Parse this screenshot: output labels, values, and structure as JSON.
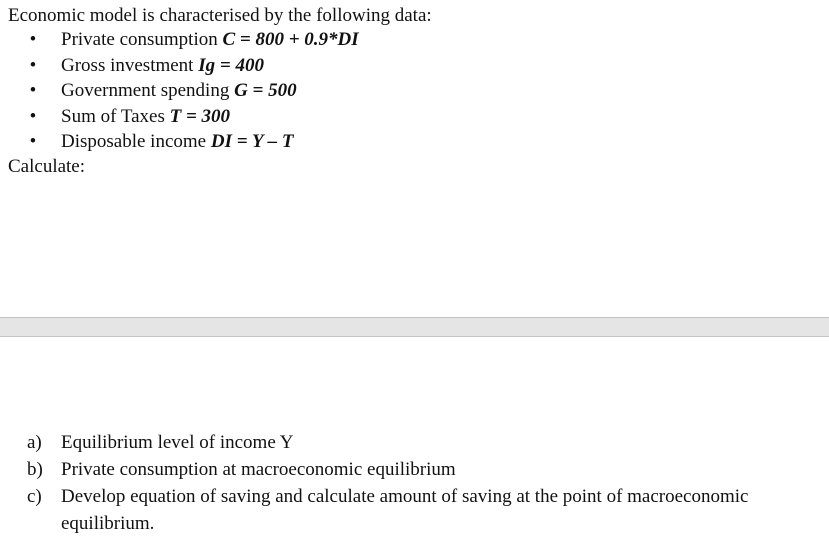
{
  "intro": "Economic model is characterised by the following data:",
  "bullet_glyph": "•",
  "bullets": [
    {
      "label": "Private consumption ",
      "equation": "C = 800 + 0.9*DI"
    },
    {
      "label": "Gross investment ",
      "equation": "Ig = 400"
    },
    {
      "label": "Government spending ",
      "equation": "G = 500"
    },
    {
      "label": "Sum of Taxes ",
      "equation": "T = 300"
    },
    {
      "label": "Disposable income ",
      "equation": "DI = Y – T"
    }
  ],
  "calculate_label": "Calculate:",
  "tasks": [
    {
      "marker": "a)",
      "text": "Equilibrium level of income Y"
    },
    {
      "marker": "b)",
      "text": "Private consumption at macroeconomic equilibrium"
    },
    {
      "marker": "c)",
      "text": "Develop equation of saving and calculate amount of saving at the point of macroeconomic equilibrium."
    }
  ]
}
